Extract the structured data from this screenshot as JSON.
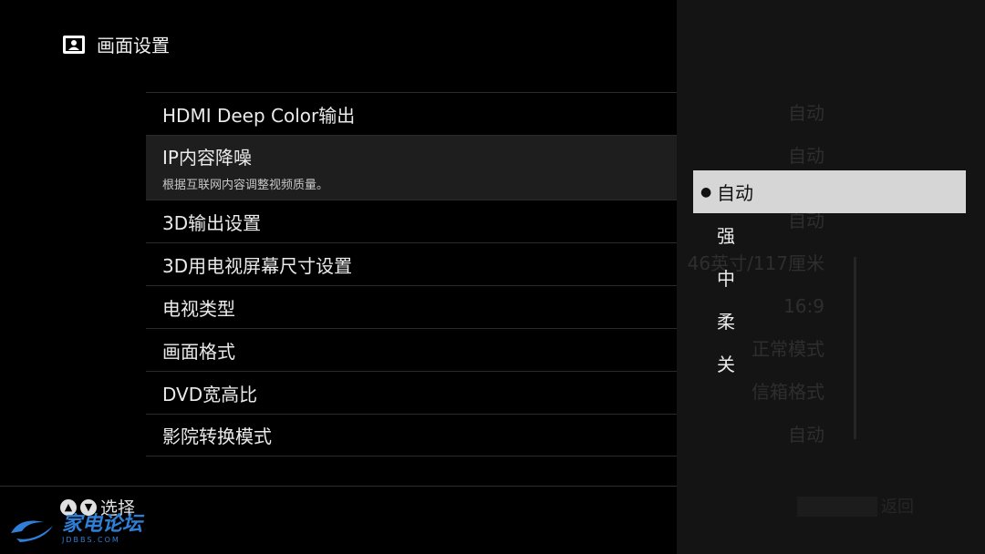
{
  "header": {
    "title": "画面设置",
    "icon": "picture-settings-icon"
  },
  "menu": {
    "items": [
      {
        "label": "HDMI Deep Color输出"
      },
      {
        "label": "IP内容降噪",
        "desc": "根据互联网内容调整视频质量。"
      },
      {
        "label": "3D输出设置"
      },
      {
        "label": "3D用电视屏幕尺寸设置"
      },
      {
        "label": "电视类型"
      },
      {
        "label": "画面格式"
      },
      {
        "label": "DVD宽高比"
      },
      {
        "label": "影院转换模式"
      }
    ]
  },
  "background_values": [
    "自动",
    "自动",
    "自动",
    "46英寸/117厘米",
    "16:9",
    "正常模式",
    "信箱格式",
    "自动"
  ],
  "options": {
    "selected_index": 0,
    "items": [
      {
        "label": "自动"
      },
      {
        "label": "强"
      },
      {
        "label": "中"
      },
      {
        "label": "柔"
      },
      {
        "label": "关"
      }
    ]
  },
  "footer": {
    "hint": "选择",
    "icons": [
      "arrow-up-icon",
      "arrow-down-icon"
    ],
    "ghost_text": "返回"
  },
  "watermark": {
    "main": "家电论坛",
    "sub": "JDBBS.COM",
    "color": "#2f7fd6"
  }
}
